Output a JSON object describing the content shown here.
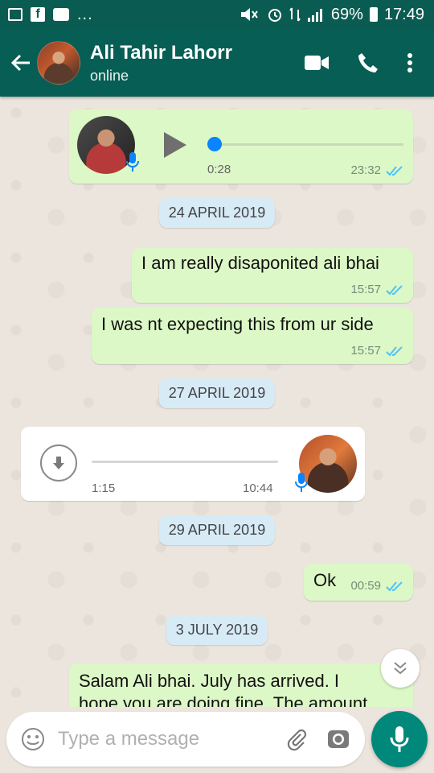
{
  "statusbar": {
    "left_icons": [
      "gallery-icon",
      "facebook-icon",
      "chat-icon",
      "more-notifications-icon"
    ],
    "facebook_glyph": "f",
    "more_indicator": "...",
    "battery": "69%",
    "time": "17:49"
  },
  "header": {
    "name": "Ali Tahir Lahorr",
    "status": "online"
  },
  "messages": {
    "voice_out": {
      "duration": "0:28",
      "time": "23:32"
    },
    "date_1": "24 APRIL 2019",
    "text_1": {
      "text": "I am really disaponited ali bhai",
      "time": "15:57"
    },
    "text_2": {
      "text": "I was nt expecting this from ur side",
      "time": "15:57"
    },
    "date_2": "27 APRIL 2019",
    "voice_in": {
      "duration": "1:15",
      "time": "10:44"
    },
    "date_3": "29 APRIL 2019",
    "text_3": {
      "text": "Ok",
      "time": "00:59"
    },
    "date_4": "3 JULY 2019",
    "text_4": {
      "line1": "Salam Ali bhai. July has arrived. I",
      "line2": "hope you are doing fine. The amount"
    }
  },
  "composer": {
    "placeholder": "Type a message"
  },
  "colors": {
    "header": "#075e54",
    "statusbar": "#0a5c52",
    "outgoing": "#dcf8c6",
    "incoming": "#ffffff",
    "date_chip": "#d7ebf7",
    "accent_fab": "#00897b",
    "tick_blue": "#4fc3f7"
  }
}
